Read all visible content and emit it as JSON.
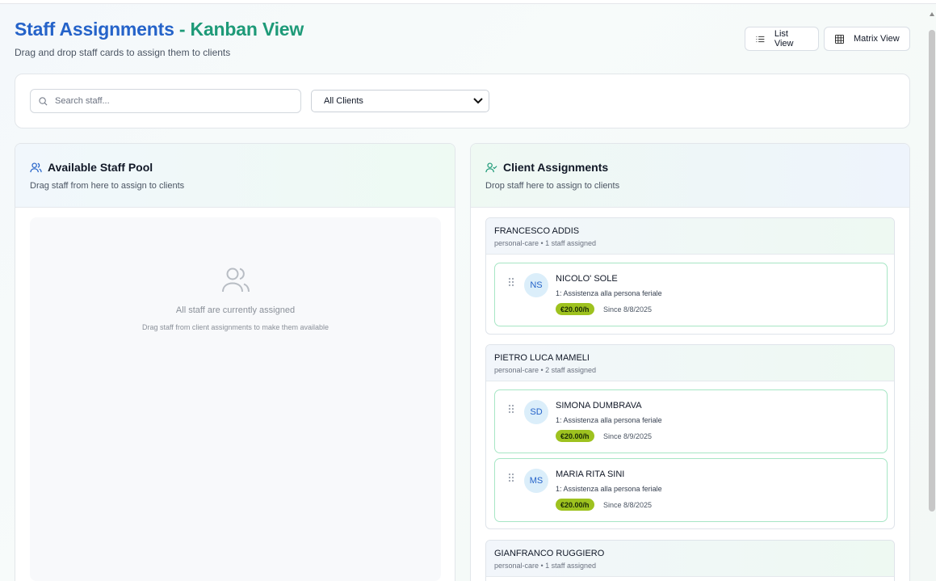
{
  "header": {
    "title_part1": "Staff Assignments",
    "title_sep": "-",
    "title_part2": "Kanban View",
    "subtitle": "Drag and drop staff cards to assign them to clients"
  },
  "view_buttons": {
    "list_label": "List View",
    "matrix_label": "Matrix View"
  },
  "filters": {
    "search_placeholder": "Search staff...",
    "client_select_value": "All Clients"
  },
  "staff_pool": {
    "title": "Available Staff Pool",
    "subtitle": "Drag staff from here to assign to clients",
    "empty_title": "All staff are currently assigned",
    "empty_subtitle": "Drag staff from client assignments to make them available"
  },
  "assignments": {
    "title": "Client Assignments",
    "subtitle": "Drop staff here to assign to clients",
    "clients": [
      {
        "name": "FRANCESCO ADDIS",
        "meta": "personal-care • 1 staff assigned",
        "staff": [
          {
            "initials": "NS",
            "name": "NICOLO' SOLE",
            "role": "1: Assistenza alla persona feriale",
            "rate": "€20.00/h",
            "since": "Since 8/8/2025"
          }
        ]
      },
      {
        "name": "PIETRO LUCA MAMELI",
        "meta": "personal-care • 2 staff assigned",
        "staff": [
          {
            "initials": "SD",
            "name": "SIMONA DUMBRAVA",
            "role": "1: Assistenza alla persona feriale",
            "rate": "€20.00/h",
            "since": "Since 8/9/2025"
          },
          {
            "initials": "MS",
            "name": "MARIA RITA SINI",
            "role": "1: Assistenza alla persona feriale",
            "rate": "€20.00/h",
            "since": "Since 8/8/2025"
          }
        ]
      },
      {
        "name": "GIANFRANCO RUGGIERO",
        "meta": "personal-care • 1 staff assigned",
        "staff": []
      }
    ]
  },
  "colors": {
    "title_blue": "#2563c9",
    "title_green": "#1e9a78",
    "rate_badge": "#9ec21f",
    "card_border": "#a7e6c5"
  }
}
